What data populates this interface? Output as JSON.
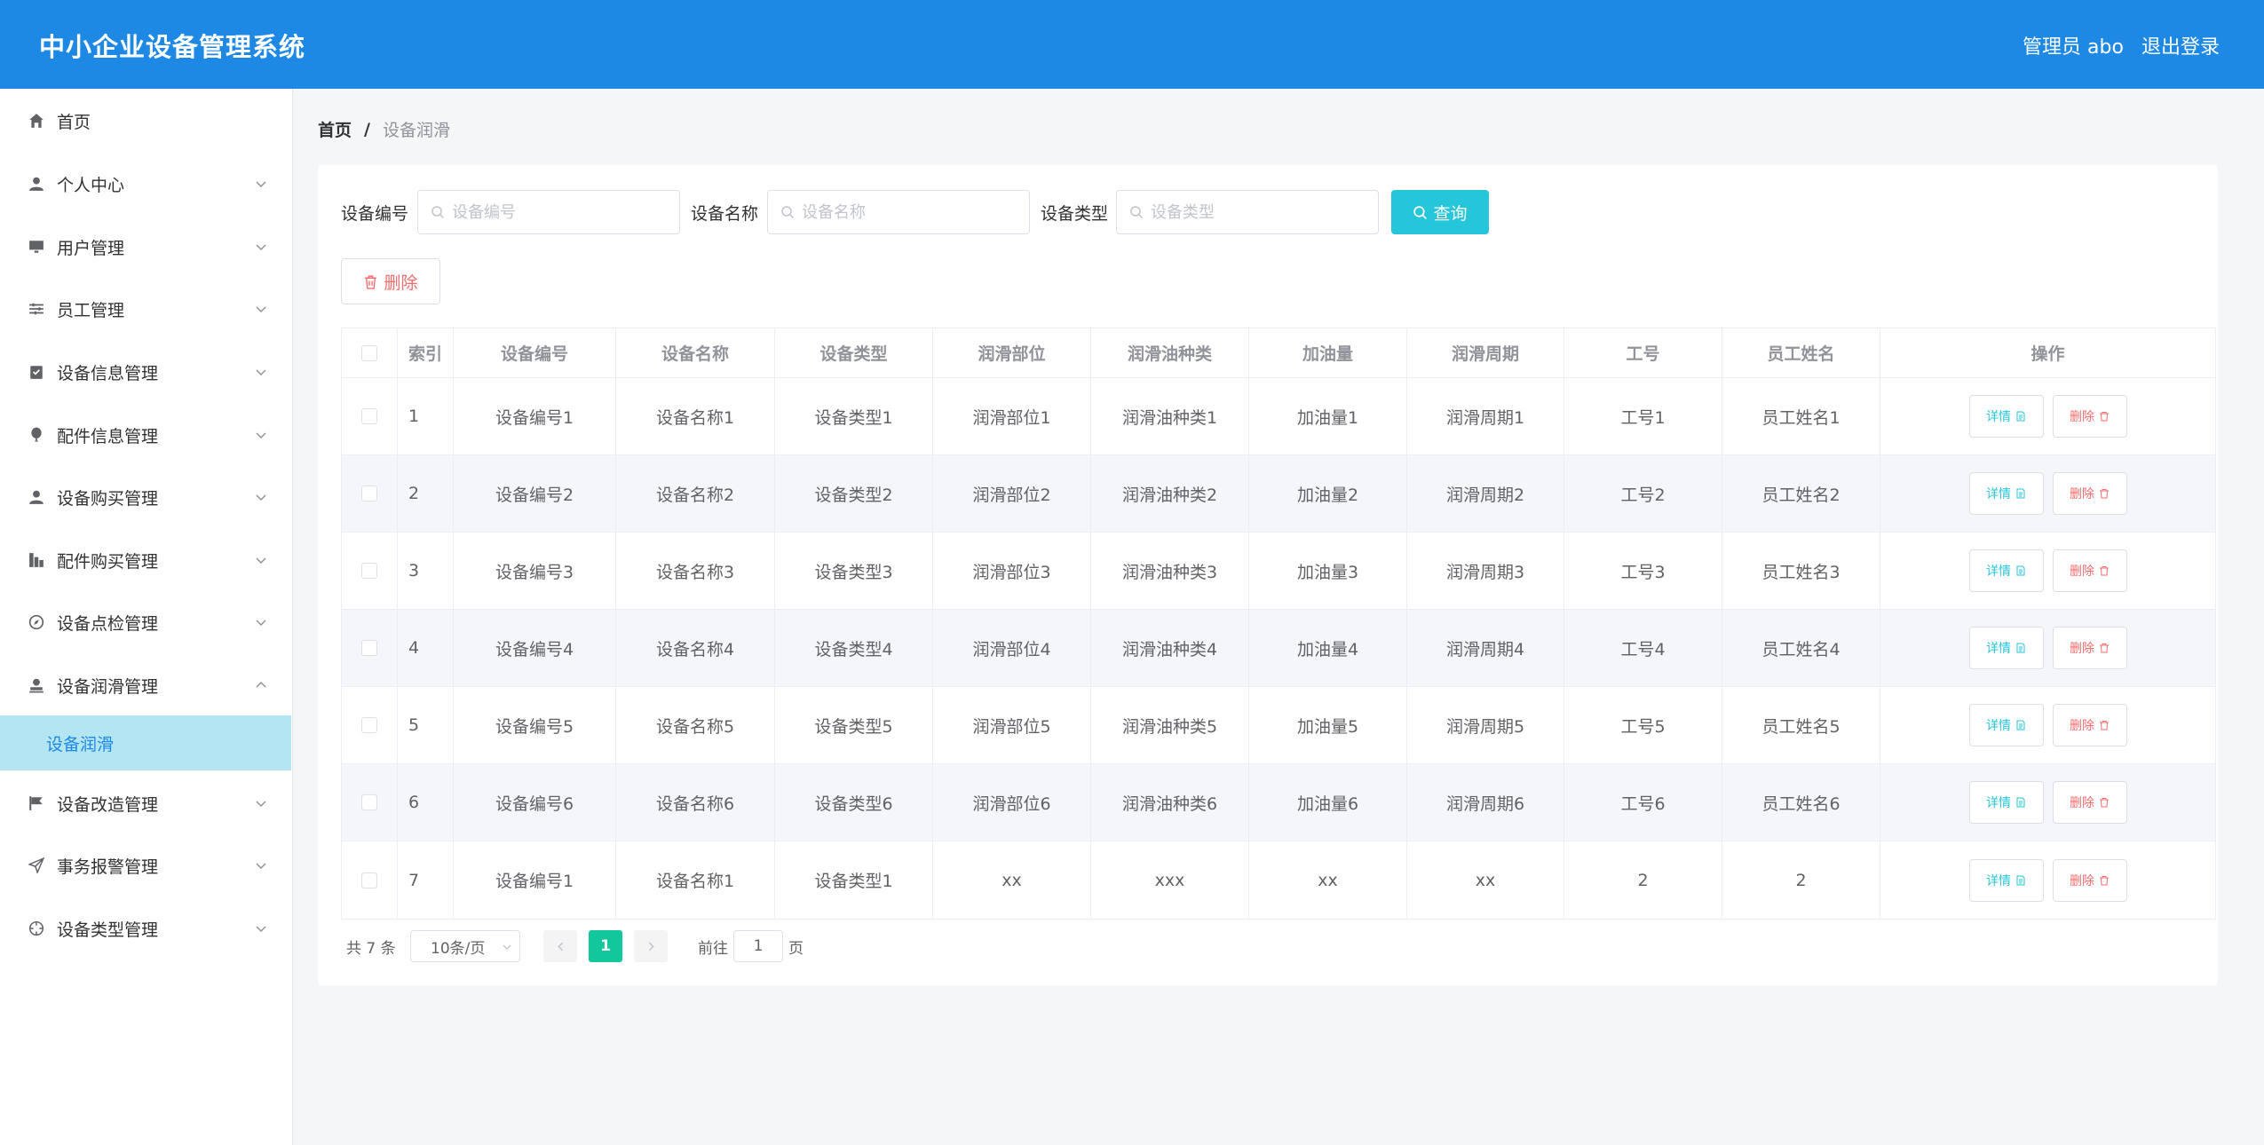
{
  "header": {
    "title": "中小企业设备管理系统",
    "user": "管理员 abo",
    "logout": "退出登录"
  },
  "sidebar": {
    "items": [
      {
        "label": "首页",
        "icon": "home-icon",
        "expandable": false
      },
      {
        "label": "个人中心",
        "icon": "user-icon",
        "expandable": true
      },
      {
        "label": "用户管理",
        "icon": "monitor-icon",
        "expandable": true
      },
      {
        "label": "员工管理",
        "icon": "sliders-icon",
        "expandable": true
      },
      {
        "label": "设备信息管理",
        "icon": "clipboard-icon",
        "expandable": true
      },
      {
        "label": "配件信息管理",
        "icon": "balloon-icon",
        "expandable": true
      },
      {
        "label": "设备购买管理",
        "icon": "user-icon",
        "expandable": true
      },
      {
        "label": "配件购买管理",
        "icon": "bar-chart-icon",
        "expandable": true
      },
      {
        "label": "设备点检管理",
        "icon": "compass-icon",
        "expandable": true
      },
      {
        "label": "设备润滑管理",
        "icon": "stamp-icon",
        "expandable": true,
        "expanded": true
      },
      {
        "label": "设备改造管理",
        "icon": "flag-icon",
        "expandable": true
      },
      {
        "label": "事务报警管理",
        "icon": "send-icon",
        "expandable": true
      },
      {
        "label": "设备类型管理",
        "icon": "crosshair-icon",
        "expandable": true
      }
    ],
    "submenu_active": "设备润滑"
  },
  "breadcrumb": {
    "home": "首页",
    "separator": "/",
    "current": "设备润滑"
  },
  "filters": [
    {
      "label": "设备编号",
      "placeholder": "设备编号",
      "value": ""
    },
    {
      "label": "设备名称",
      "placeholder": "设备名称",
      "value": ""
    },
    {
      "label": "设备类型",
      "placeholder": "设备类型",
      "value": ""
    }
  ],
  "buttons": {
    "query": "查询",
    "delete": "删除",
    "detail": "详情",
    "row_delete": "删除"
  },
  "table": {
    "columns": [
      "索引",
      "设备编号",
      "设备名称",
      "设备类型",
      "润滑部位",
      "润滑油种类",
      "加油量",
      "润滑周期",
      "工号",
      "员工姓名",
      "操作"
    ],
    "rows": [
      [
        "1",
        "设备编号1",
        "设备名称1",
        "设备类型1",
        "润滑部位1",
        "润滑油种类1",
        "加油量1",
        "润滑周期1",
        "工号1",
        "员工姓名1"
      ],
      [
        "2",
        "设备编号2",
        "设备名称2",
        "设备类型2",
        "润滑部位2",
        "润滑油种类2",
        "加油量2",
        "润滑周期2",
        "工号2",
        "员工姓名2"
      ],
      [
        "3",
        "设备编号3",
        "设备名称3",
        "设备类型3",
        "润滑部位3",
        "润滑油种类3",
        "加油量3",
        "润滑周期3",
        "工号3",
        "员工姓名3"
      ],
      [
        "4",
        "设备编号4",
        "设备名称4",
        "设备类型4",
        "润滑部位4",
        "润滑油种类4",
        "加油量4",
        "润滑周期4",
        "工号4",
        "员工姓名4"
      ],
      [
        "5",
        "设备编号5",
        "设备名称5",
        "设备类型5",
        "润滑部位5",
        "润滑油种类5",
        "加油量5",
        "润滑周期5",
        "工号5",
        "员工姓名5"
      ],
      [
        "6",
        "设备编号6",
        "设备名称6",
        "设备类型6",
        "润滑部位6",
        "润滑油种类6",
        "加油量6",
        "润滑周期6",
        "工号6",
        "员工姓名6"
      ],
      [
        "7",
        "设备编号1",
        "设备名称1",
        "设备类型1",
        "xx",
        "xxx",
        "xx",
        "xx",
        "2",
        "2"
      ]
    ]
  },
  "pagination": {
    "total": "共 7 条",
    "page_size": "10条/页",
    "current_page": "1",
    "goto_label": "前往",
    "goto_value": "1",
    "page_unit": "页"
  },
  "colors": {
    "header": "#1e88e5",
    "active_submenu_bg": "#b3e5f3",
    "query_button": "#26c6da",
    "current_page": "#13c79c",
    "danger": "#f56c6c"
  }
}
